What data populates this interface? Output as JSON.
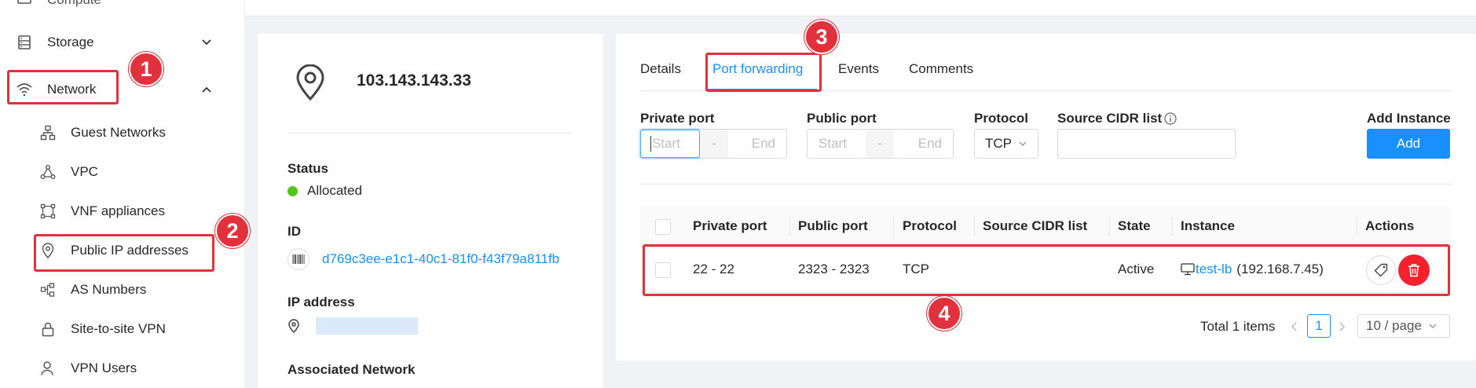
{
  "sidebar": {
    "items": [
      {
        "label": "Compute"
      },
      {
        "label": "Storage"
      },
      {
        "label": "Network"
      }
    ],
    "sub_items": [
      {
        "label": "Guest Networks"
      },
      {
        "label": "VPC"
      },
      {
        "label": "VNF appliances"
      },
      {
        "label": "Public IP addresses"
      },
      {
        "label": "AS Numbers"
      },
      {
        "label": "Site-to-site VPN"
      },
      {
        "label": "VPN Users"
      }
    ]
  },
  "details": {
    "ip_title": "103.143.143.33",
    "status_label": "Status",
    "status_value": "Allocated",
    "id_label": "ID",
    "id_value": "d769c3ee-e1c1-40c1-81f0-f43f79a811fb",
    "ip_label": "IP address",
    "network_label": "Associated Network"
  },
  "tabs": [
    {
      "label": "Details"
    },
    {
      "label": "Port forwarding"
    },
    {
      "label": "Events"
    },
    {
      "label": "Comments"
    }
  ],
  "form": {
    "private_port_label": "Private port",
    "public_port_label": "Public port",
    "protocol_label": "Protocol",
    "cidr_label": "Source CIDR list",
    "add_instance_label": "Add Instance",
    "start_placeholder": "Start",
    "end_placeholder": "End",
    "dash": "-",
    "protocol_value": "TCP",
    "add_button": "Add"
  },
  "table": {
    "headers": [
      "Private port",
      "Public port",
      "Protocol",
      "Source CIDR list",
      "State",
      "Instance",
      "Actions"
    ],
    "rows": [
      {
        "private_port": "22 - 22",
        "public_port": "2323 - 2323",
        "protocol": "TCP",
        "cidr": "",
        "state": "Active",
        "instance_name": "test-lb",
        "instance_ip": "(192.168.7.45)"
      }
    ]
  },
  "pagination": {
    "total": "Total 1 items",
    "current_page": "1",
    "page_size": "10 / page"
  },
  "annotations": [
    "1",
    "2",
    "3",
    "4"
  ],
  "colors": {
    "accent": "#1890ff",
    "annotation": "#e0313d",
    "success": "#52c41a",
    "danger": "#f5222d"
  }
}
